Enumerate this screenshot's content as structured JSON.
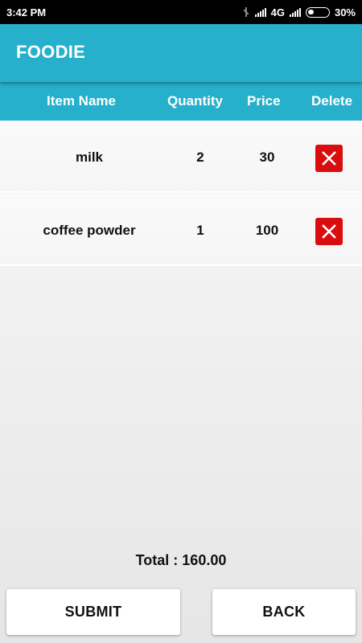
{
  "status_bar": {
    "time": "3:42 PM",
    "network": "4G",
    "battery": "30%"
  },
  "app_bar": {
    "title": "FOODIE"
  },
  "table": {
    "columns": [
      "Item Name",
      "Quantity",
      "Price",
      "Delete"
    ],
    "rows": [
      {
        "name": "milk",
        "quantity": "2",
        "price": "30",
        "delete_icon": "close-icon"
      },
      {
        "name": "coffee powder",
        "quantity": "1",
        "price": "100",
        "delete_icon": "close-icon"
      }
    ]
  },
  "total": {
    "label": "Total : 160.00"
  },
  "buttons": {
    "submit": "SUBMIT",
    "back": "BACK"
  },
  "colors": {
    "accent": "#26b0cc",
    "delete": "#d90d0d"
  }
}
